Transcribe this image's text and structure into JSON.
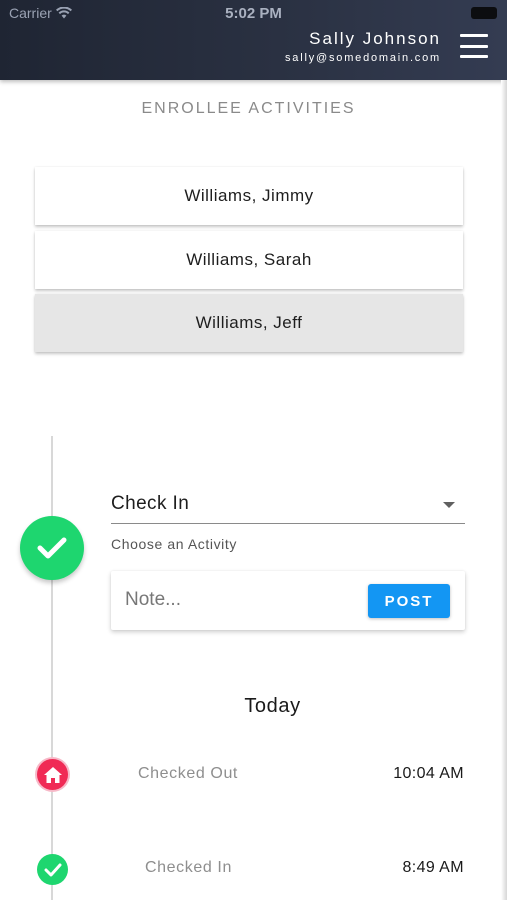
{
  "status_bar": {
    "carrier": "Carrier",
    "time": "5:02 PM",
    "wifi_icon": "wifi-icon",
    "battery_icon": "battery-icon"
  },
  "header": {
    "user_name": "Sally Johnson",
    "user_email": "sally@somedomain.com",
    "menu_icon": "hamburger-menu-icon",
    "background": "#252c3b"
  },
  "enrollees": {
    "title": "ENROLLEE ACTIVITIES",
    "items": [
      {
        "label": "Williams, Jimmy",
        "selected": false
      },
      {
        "label": "Williams, Sarah",
        "selected": false
      },
      {
        "label": "Williams, Jeff",
        "selected": true
      }
    ]
  },
  "activity_form": {
    "status_icon": "check-icon",
    "activity_value": "Check In",
    "activity_helper": "Choose an Activity",
    "note_placeholder": "Note...",
    "note_value": "",
    "post_label": "POST"
  },
  "timeline": {
    "day_label": "Today",
    "events": [
      {
        "label": "Checked Out",
        "time": "10:04 AM",
        "icon": "home-icon",
        "color": "#f02a55"
      },
      {
        "label": "Checked In",
        "time": "8:49 AM",
        "icon": "check-icon",
        "color": "#1ed66f"
      }
    ]
  },
  "colors": {
    "accent": "#1396f3",
    "success": "#1ed66f",
    "danger": "#f02a55"
  }
}
